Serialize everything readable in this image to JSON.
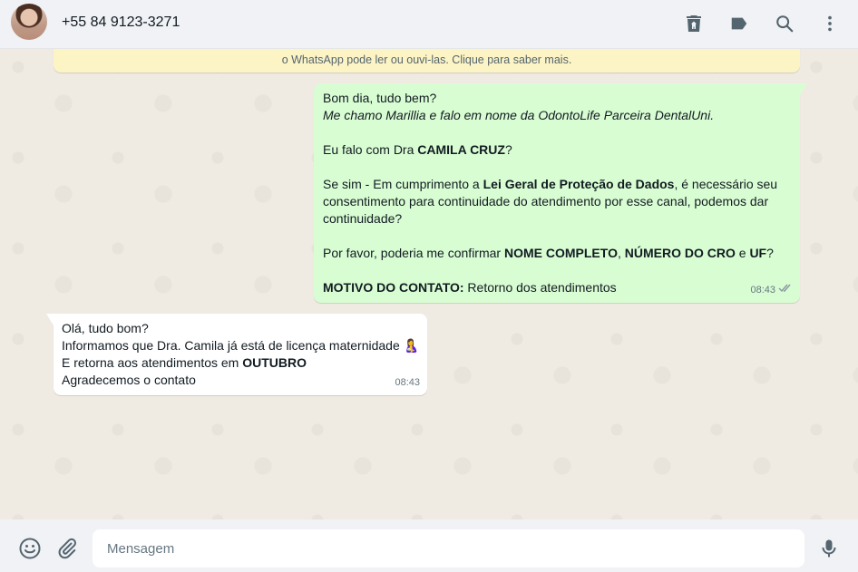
{
  "header": {
    "contact_name": "+55 84 9123-3271",
    "icons": [
      "delete-icon",
      "label-icon",
      "search-icon",
      "menu-icon"
    ]
  },
  "notice": {
    "text": "o WhatsApp pode ler ou ouvi-las. Clique para saber mais."
  },
  "messages": [
    {
      "direction": "outgoing",
      "time": "08:43",
      "status": "delivered",
      "l1": "Bom dia, tudo bem?",
      "l2": "Me chamo Marillia e falo em nome da OdontoLife Parceira DentalUni.",
      "l3a": "Eu falo com Dra ",
      "l3b": "CAMILA CRUZ",
      "l3c": "?",
      "l4a": "Se sim - Em cumprimento a ",
      "l4b": "Lei Geral de Proteção de Dados",
      "l4c": ", é necessário seu",
      "l5": "consentimento para continuidade do atendimento por esse canal, podemos dar",
      "l6": "continuidade?",
      "l7a": "Por favor, poderia me confirmar ",
      "l7b": "NOME COMPLETO",
      "l7c": ", ",
      "l7d": "NÚMERO DO CRO",
      "l7e": " e ",
      "l7f": "UF",
      "l7g": "?",
      "l8a": "MOTIVO DO CONTATO:",
      "l8b": " Retorno dos atendimentos"
    },
    {
      "direction": "incoming",
      "time": "08:43",
      "l1": "Olá, tudo bom?",
      "l2": "Informamos que Dra. Camila já está de licença maternidade ",
      "l2_emoji": "🤱",
      "l3a": "E retorna aos atendimentos em ",
      "l3b": "OUTUBRO",
      "l4": "Agradecemos o contato"
    }
  ],
  "footer": {
    "placeholder": "Mensagem",
    "icons": [
      "emoji-icon",
      "attach-icon",
      "mic-icon"
    ]
  },
  "colors": {
    "outgoing_bubble": "#d9fdd3",
    "incoming_bubble": "#ffffff",
    "chat_background": "#efeae2",
    "notice_background": "#fdf4c5"
  }
}
